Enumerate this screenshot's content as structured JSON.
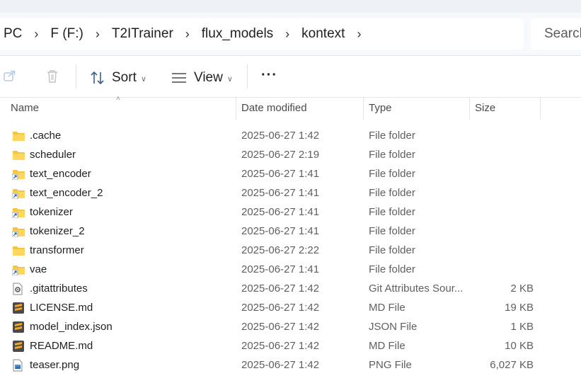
{
  "breadcrumb": [
    "PC",
    "F (F:)",
    "T2ITrainer",
    "flux_models",
    "kontext"
  ],
  "search": {
    "placeholder": "Search"
  },
  "toolbar": {
    "sort_label": "Sort",
    "view_label": "View",
    "more_label": "···"
  },
  "columns": {
    "name": "Name",
    "date": "Date modified",
    "type": "Type",
    "size": "Size"
  },
  "files": [
    {
      "name": ".cache",
      "date": "2025-06-27 1:42",
      "type": "File folder",
      "size": "",
      "icon": "folder-icon"
    },
    {
      "name": "scheduler",
      "date": "2025-06-27 2:19",
      "type": "File folder",
      "size": "",
      "icon": "folder-icon"
    },
    {
      "name": "text_encoder",
      "date": "2025-06-27 1:41",
      "type": "File folder",
      "size": "",
      "icon": "folder-shortcut-icon"
    },
    {
      "name": "text_encoder_2",
      "date": "2025-06-27 1:41",
      "type": "File folder",
      "size": "",
      "icon": "folder-shortcut-icon"
    },
    {
      "name": "tokenizer",
      "date": "2025-06-27 1:41",
      "type": "File folder",
      "size": "",
      "icon": "folder-shortcut-icon"
    },
    {
      "name": "tokenizer_2",
      "date": "2025-06-27 1:41",
      "type": "File folder",
      "size": "",
      "icon": "folder-shortcut-icon"
    },
    {
      "name": "transformer",
      "date": "2025-06-27 2:22",
      "type": "File folder",
      "size": "",
      "icon": "folder-icon"
    },
    {
      "name": "vae",
      "date": "2025-06-27 1:41",
      "type": "File folder",
      "size": "",
      "icon": "folder-shortcut-icon"
    },
    {
      "name": ".gitattributes",
      "date": "2025-06-27 1:42",
      "type": "Git Attributes Sour...",
      "size": "2 KB",
      "icon": "gear-file-icon"
    },
    {
      "name": "LICENSE.md",
      "date": "2025-06-27 1:42",
      "type": "MD File",
      "size": "19 KB",
      "icon": "sublime-file-icon"
    },
    {
      "name": "model_index.json",
      "date": "2025-06-27 1:42",
      "type": "JSON File",
      "size": "1 KB",
      "icon": "sublime-file-icon"
    },
    {
      "name": "README.md",
      "date": "2025-06-27 1:42",
      "type": "MD File",
      "size": "10 KB",
      "icon": "sublime-file-icon"
    },
    {
      "name": "teaser.png",
      "date": "2025-06-27 1:42",
      "type": "PNG File",
      "size": "6,027 KB",
      "icon": "image-file-icon"
    }
  ]
}
